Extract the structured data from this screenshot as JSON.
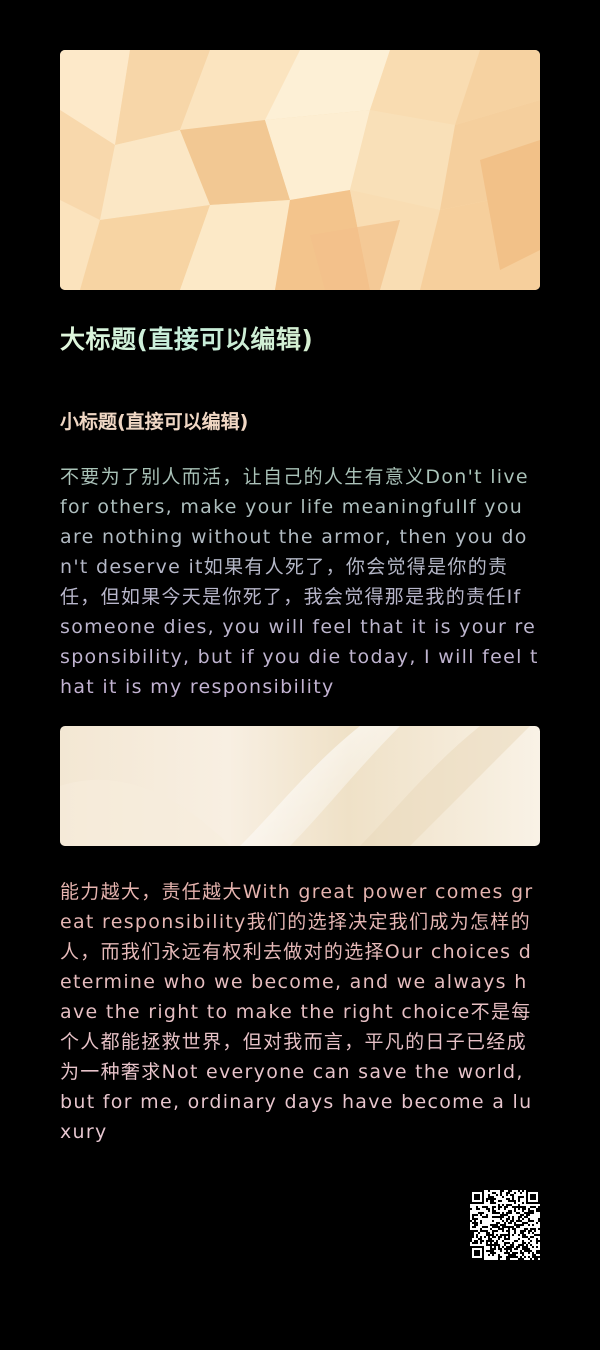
{
  "header": {
    "title": "大标题(直接可以编辑)",
    "subtitle": "小标题(直接可以编辑)"
  },
  "paragraphs": {
    "first": "不要为了别人而活，让自己的人生有意义Don't live for others, make your life meaningfulIf you are nothing without the armor, then you don't deserve it如果有人死了，你会觉得是你的责任，但如果今天是你死了，我会觉得那是我的责任If someone dies, you will feel that it is your responsibility, but if you die today, I will feel that it is my responsibility",
    "second": "能力越大，责任越大With great power comes great responsibility我们的选择决定我们成为怎样的人，而我们永远有权利去做对的选择Our choices determine who we become, and we always have the right to make the right choice不是每个人都能拯救世界，但对我而言，平凡的日子已经成为一种奢求Not everyone can save the world, but for me, ordinary days have become a luxury"
  },
  "images": {
    "top_banner": "peach-low-poly-pattern",
    "mid_banner": "cream-silk-fabric",
    "qr_code": "qr-code"
  },
  "colors": {
    "background": "#000000",
    "title": "#d6f0d4",
    "subtitle": "#f0d7c4",
    "paragraph_1": "#b6b8c9",
    "paragraph_2": "#e7c0c4",
    "peach_light": "#fbe6c6",
    "peach_dark": "#f3bd8b"
  }
}
